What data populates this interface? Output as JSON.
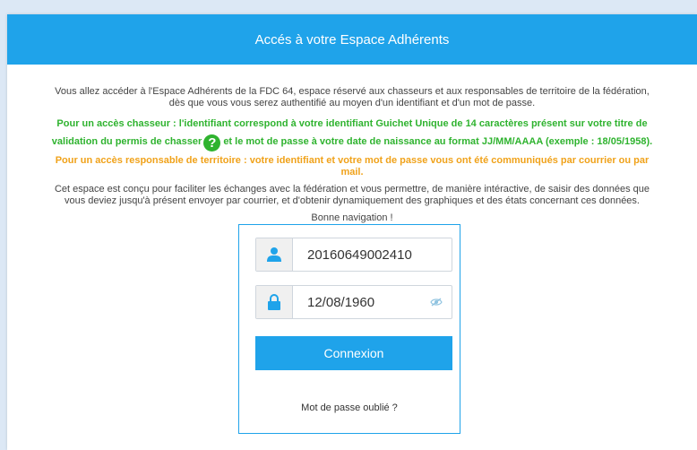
{
  "header": {
    "title": "Accés à votre Espace Adhérents"
  },
  "intro": {
    "line1": "Vous allez accéder à l'Espace Adhérents de la FDC 64, espace réservé aux chasseurs et aux responsables de territoire de la fédération,",
    "line2": "dès que vous vous serez authentifié au moyen d'un identifiant et d'un mot de passe."
  },
  "chasseur": {
    "line1": "Pour un accès chasseur : l'identifiant correspond à votre identifiant Guichet Unique de 14 caractères présent sur votre titre de",
    "line2a": "validation du permis de chasser",
    "help_icon": "?",
    "line2b": "et le mot de passe à votre date de naissance au format JJ/MM/AAAA (exemple : 18/05/1958)."
  },
  "territoire": {
    "line1": "Pour un accès responsable de territoire : votre identifiant et votre mot de passe vous ont été communiqués par courrier ou par",
    "line2": "mail."
  },
  "description": {
    "line1": "Cet espace est conçu pour faciliter les échanges avec la fédération et vous permettre, de manière intéractive, de saisir des données que",
    "line2": "vous deviez jusqu'à présent envoyer par courrier, et d'obtenir dynamiquement des graphiques et des états concernant ces données."
  },
  "greeting": "Bonne navigation !",
  "login": {
    "username_value": "20160649002410",
    "password_value": "12/08/1960",
    "connect_label": "Connexion",
    "forgot_label": "Mot de passe oublié ?",
    "user_icon": "user-icon",
    "lock_icon": "lock-icon",
    "eye_icon": "eye-slash-icon"
  },
  "colors": {
    "accent": "#1fa3ea",
    "green": "#2fb32f",
    "orange": "#f0a21a"
  }
}
